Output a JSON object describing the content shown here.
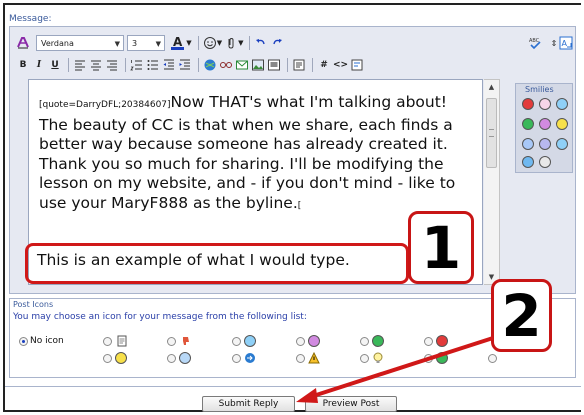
{
  "message_label": "Message:",
  "toolbar": {
    "font_family": "Verdana",
    "font_size": "3",
    "font_color_letter": "A",
    "bold": "B",
    "italic": "I",
    "underline": "U",
    "hash": "#",
    "code": "<>"
  },
  "editor": {
    "quote_tag": "[quote=DarryDFL;20384607]",
    "body_text": "Now THAT's what I'm talking about! The beauty of CC is that when we share, each finds a better way because someone has already created it. Thank you so much for sharing. I'll be modifying the lesson on my website, and - if you don't mind - like to use your MaryF888 as the byline.",
    "closing_fragment": "[",
    "typed_text": "This is an example of what I would type."
  },
  "smilies": {
    "title": "Smilies"
  },
  "callouts": {
    "one": "1",
    "two": "2"
  },
  "post_icons": {
    "title": "Post Icons",
    "description": "You may choose an icon for your message from the following list:",
    "no_icon_label": "No icon",
    "selected": "No icon"
  },
  "buttons": {
    "submit": "Submit Reply",
    "preview": "Preview Post"
  },
  "colors": {
    "accent_red": "#d01818",
    "label_blue": "#3a5a9b",
    "panel_bg": "#e6e9f2"
  }
}
